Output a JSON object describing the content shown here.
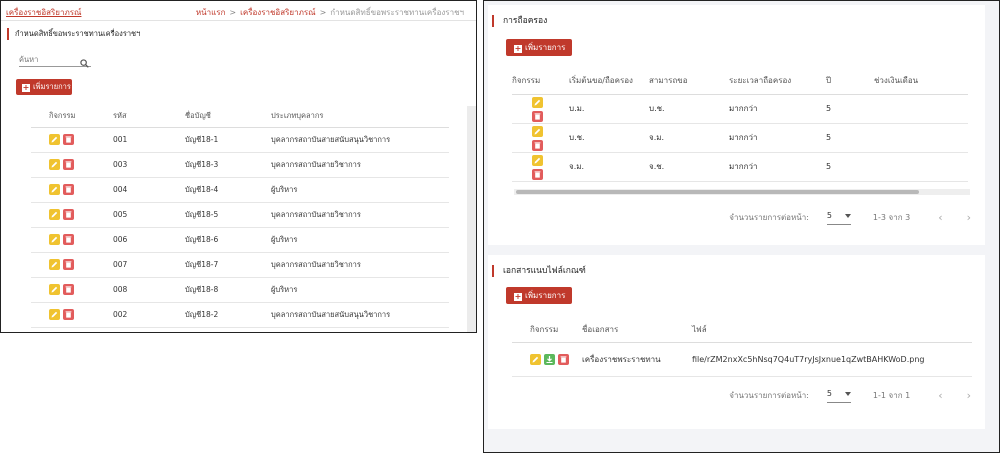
{
  "left": {
    "app_title": "เครื่องราชอิสริยาภรณ์",
    "breadcrumb": [
      "หน้าแรก",
      "เครื่องราชอิสริยาภรณ์",
      "กำหนดสิทธิ์ขอพระราชทานเครื่องราชฯ"
    ],
    "section_title": "กำหนดสิทธิ์ขอพระราชทานเครื่องราชฯ",
    "search_placeholder": "ค้นหา",
    "add_label": "เพิ่มรายการ",
    "columns": [
      "กิจกรรม",
      "รหัส",
      "ชื่อบัญชี",
      "ประเภทบุคลากร"
    ],
    "rows": [
      {
        "code": "001",
        "account": "บัญชี18-1",
        "type": "บุคลากรสถาบันสายสนับสนุนวิชาการ"
      },
      {
        "code": "003",
        "account": "บัญชี18-3",
        "type": "บุคลากรสถาบันสายวิชาการ"
      },
      {
        "code": "004",
        "account": "บัญชี18-4",
        "type": "ผู้บริหาร"
      },
      {
        "code": "005",
        "account": "บัญชี18-5",
        "type": "บุคลากรสถาบันสายวิชาการ"
      },
      {
        "code": "006",
        "account": "บัญชี18-6",
        "type": "ผู้บริหาร"
      },
      {
        "code": "007",
        "account": "บัญชี18-7",
        "type": "บุคลากรสถาบันสายวิชาการ"
      },
      {
        "code": "008",
        "account": "บัญชี18-8",
        "type": "ผู้บริหาร"
      },
      {
        "code": "002",
        "account": "บัญชี18-2",
        "type": "บุคลากรสถาบันสายสนับสนุนวิชาการ"
      }
    ]
  },
  "holding": {
    "title": "การถือครอง",
    "add_label": "เพิ่มรายการ",
    "columns": [
      "กิจกรรม",
      "เริ่มต้นขอ/ถือครอง",
      "สามารถขอ",
      "ระยะเวลาถือครอง",
      "ปี",
      "ช่วงเงินเดือน"
    ],
    "rows": [
      {
        "start": "บ.ม.",
        "can": "บ.ช.",
        "duration": "มากกว่า",
        "years": "5",
        "salary": ""
      },
      {
        "start": "บ.ช.",
        "can": "จ.ม.",
        "duration": "มากกว่า",
        "years": "5",
        "salary": ""
      },
      {
        "start": "จ.ม.",
        "can": "จ.ช.",
        "duration": "มากกว่า",
        "years": "5",
        "salary": ""
      }
    ],
    "pager": {
      "label": "จำนวนรายการต่อหน้า:",
      "per_page": "5",
      "range": "1-3 จาก 3",
      "prev": "‹",
      "next": "›"
    }
  },
  "documents": {
    "title": "เอกสารแนบไฟล์เกณฑ์",
    "add_label": "เพิ่มรายการ",
    "columns": [
      "กิจกรรม",
      "ชื่อเอกสาร",
      "ไฟล์"
    ],
    "rows": [
      {
        "name": "เครื่องราชพระราชทาน",
        "file": "file/rZM2nxXc5hNsq7Q4uT7ryJsJxnue1qZwtBAHKWoD.png"
      }
    ],
    "pager": {
      "label": "จำนวนรายการต่อหน้า:",
      "per_page": "5",
      "range": "1-1 จาก 1",
      "prev": "‹",
      "next": "›"
    }
  },
  "icons": {
    "edit": "pencil-icon",
    "delete": "trash-icon",
    "download": "download-icon",
    "search": "search-icon",
    "add": "plus-icon"
  },
  "colors": {
    "brand": "#c0392b",
    "edit": "#f0c330",
    "delete": "#e25c5c",
    "download": "#5cb85c"
  }
}
